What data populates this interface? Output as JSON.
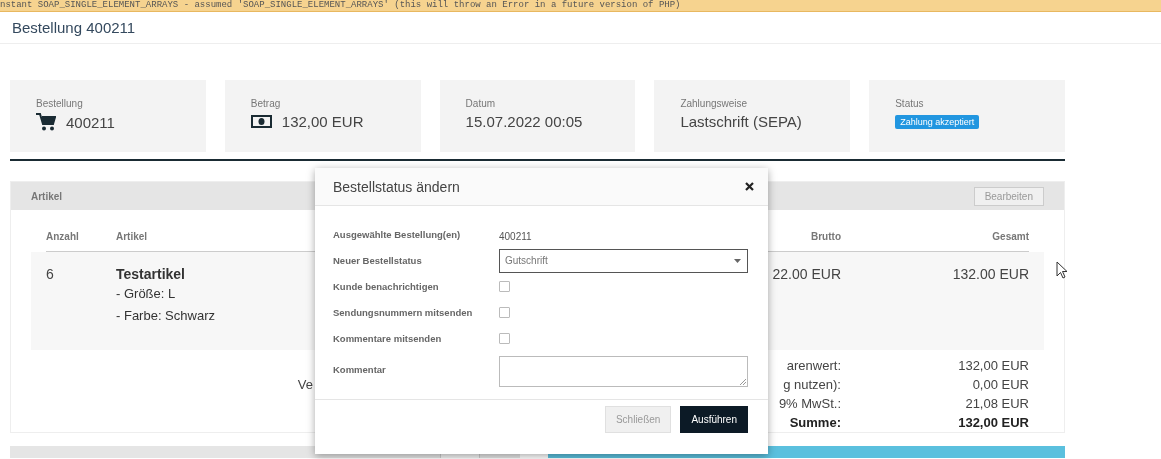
{
  "notice": {
    "text": "nstant SOAP_SINGLE_ELEMENT_ARRAYS - assumed 'SOAP_SINGLE_ELEMENT_ARRAYS' (this will throw an Error in a future version of PHP)"
  },
  "page_title": "Bestellung 400211",
  "summary_cards": [
    {
      "kind": "order",
      "label": "Bestellung",
      "value": "400211"
    },
    {
      "kind": "amount",
      "label": "Betrag",
      "value": "132,00 EUR"
    },
    {
      "kind": "text",
      "label": "Datum",
      "value": "15.07.2022 00:05"
    },
    {
      "kind": "text",
      "label": "Zahlungsweise",
      "value": "Lastschrift (SEPA)"
    },
    {
      "kind": "badge",
      "label": "Status",
      "value": "Zahlung akzeptiert"
    }
  ],
  "articles_panel": {
    "title": "Artikel",
    "edit_button": "Bearbeiten",
    "columns": [
      "Anzahl",
      "Artikel",
      "Brutto",
      "Gesamt"
    ],
    "rows": [
      {
        "quantity": "6",
        "name": "Testartikel",
        "attributes": [
          "- Größe: L",
          "- Farbe: Schwarz"
        ],
        "gross": "22.00 EUR",
        "total": "132.00 EUR"
      }
    ],
    "totals": [
      {
        "kind": "line",
        "label": "arenwert:",
        "value": "132,00 EUR"
      },
      {
        "kind": "line",
        "label_left": "Ve",
        "label": "g nutzen):",
        "value": "0,00 EUR"
      },
      {
        "kind": "line",
        "label": "9% MwSt.:",
        "value": "21,08 EUR"
      },
      {
        "kind": "sum",
        "label": "Summe:",
        "value": "132,00 EUR"
      }
    ]
  },
  "modal": {
    "title": "Bestellstatus ändern",
    "fields": [
      {
        "kind": "text",
        "label": "Ausgewählte Bestellung(en)",
        "value": "400211"
      },
      {
        "kind": "select",
        "label": "Neuer Bestellstatus",
        "value": "Gutschrift"
      },
      {
        "kind": "checkbox",
        "label": "Kunde benachrichtigen",
        "checked": false
      },
      {
        "kind": "checkbox",
        "label": "Sendungsnummern mitsenden",
        "checked": false
      },
      {
        "kind": "checkbox",
        "label": "Kommentare mitsenden",
        "checked": false
      },
      {
        "kind": "textarea",
        "label": "Kommentar"
      }
    ],
    "buttons": [
      {
        "kind": "secondary",
        "label": "Schließen"
      },
      {
        "kind": "primary",
        "label": "Ausführen"
      }
    ]
  }
}
